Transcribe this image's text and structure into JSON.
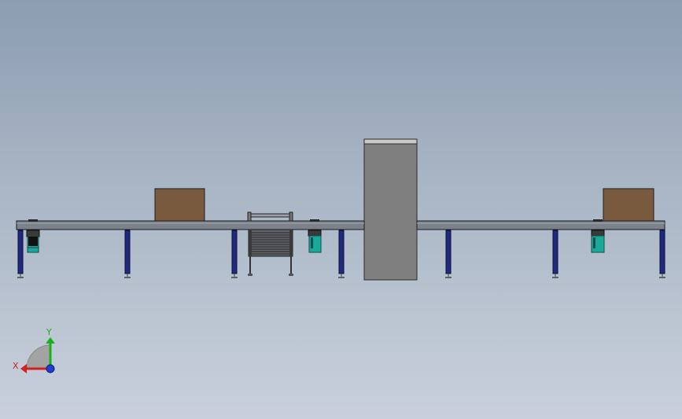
{
  "viewport": {
    "name": "cad-graphics-area",
    "background_top": "#8c9db1",
    "background_bottom": "#c9d0dc"
  },
  "model": {
    "conveyor_belt_color": "#7b828b",
    "leg_color": "#1f2a7a",
    "motor_color": "#1aa89a",
    "box_color": "#7a5a3e",
    "scanner_color": "#7f7f7f",
    "scanner_top_color": "#c8c8c8"
  },
  "triad": {
    "x_label": "X",
    "y_label": "Y",
    "x_color": "#d21f1f",
    "y_color": "#19b019",
    "z_color": "#1f3fd2"
  }
}
